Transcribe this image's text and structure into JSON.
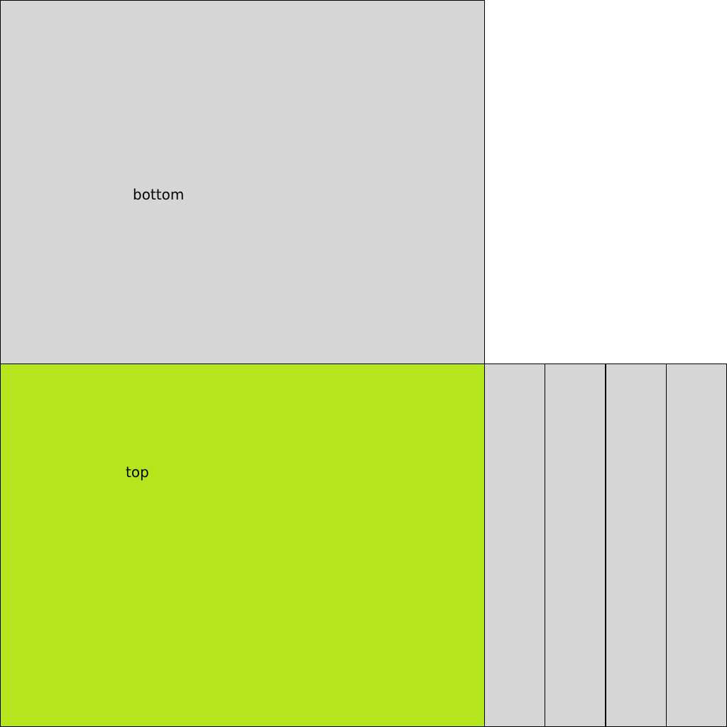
{
  "panels": {
    "bottom": {
      "label": "bottom",
      "color": "#d6d6d6"
    },
    "top": {
      "label": "top",
      "color": "#b5e61d"
    },
    "strips": {
      "count": 4,
      "color": "#d6d6d6"
    }
  },
  "colors": {
    "border": "#000000",
    "background": "#ffffff"
  }
}
